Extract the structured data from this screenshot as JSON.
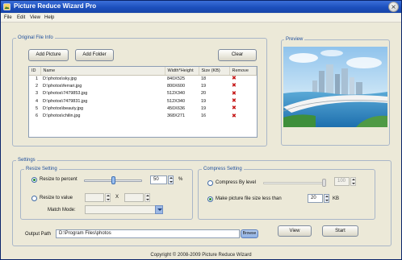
{
  "window": {
    "title": "Picture Reduce Wizard Pro"
  },
  "menu": [
    "File",
    "Edit",
    "View",
    "Help"
  ],
  "original_file_info": {
    "legend": "Original File Info",
    "add_picture": "Add Picture",
    "add_folder": "Add Folder",
    "clear": "Clear",
    "columns": [
      "ID",
      "Name",
      "Width*Height",
      "Size (KB)",
      "Remove"
    ],
    "rows": [
      {
        "id": "1",
        "name": "D:\\photos\\sky.jpg",
        "dims": "840X525",
        "size": "18"
      },
      {
        "id": "2",
        "name": "D:\\photos\\ferrari.jpg",
        "dims": "800X600",
        "size": "19"
      },
      {
        "id": "3",
        "name": "D:\\photos\\7479853.jpg",
        "dims": "512X340",
        "size": "20"
      },
      {
        "id": "4",
        "name": "D:\\photos\\7479831.jpg",
        "dims": "512X340",
        "size": "19"
      },
      {
        "id": "5",
        "name": "D:\\photos\\beauty.jpg",
        "dims": "450X636",
        "size": "19"
      },
      {
        "id": "6",
        "name": "D:\\photos\\chilin.jpg",
        "dims": "368X271",
        "size": "16"
      }
    ],
    "remove_icon": "red-x-icon"
  },
  "preview": {
    "label": "Preview"
  },
  "settings": {
    "legend": "Settings",
    "resize": {
      "legend": "Resize Setting",
      "percent_label": "Resize to percent",
      "percent_value": "50",
      "percent_unit": "%",
      "value_label": "Resize to value",
      "x_sep": "X",
      "match_mode_label": "Match Mode:",
      "selected": "percent",
      "percent_slider_fraction": 0.5
    },
    "compress": {
      "legend": "Compress Setting",
      "by_level_label": "Compress By level",
      "level_value": "100",
      "make_less_label": "Make  picture file size less than",
      "size_value": "20",
      "size_unit": "KB",
      "selected": "size",
      "level_slider_fraction": 1.0
    },
    "output_path_label": "Output Path",
    "output_path_value": "D:\\Program Files\\photos",
    "browse": "Browse",
    "view": "View",
    "start": "Start"
  },
  "footer": "Copyright © 2008-2009 Picture Reduce Wizard",
  "colors": {
    "title_bar": "#1c4fbd",
    "window_bg": "#ece9d8",
    "remove_x": "#c41212",
    "group_label": "#1f4f9c"
  }
}
